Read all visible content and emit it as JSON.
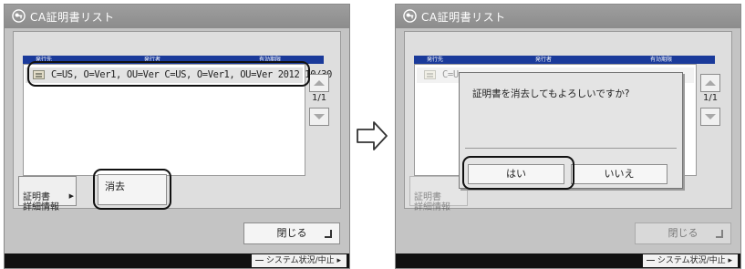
{
  "left_screen": {
    "title": "CA証明書リスト",
    "columns": [
      "発行先",
      "発行者",
      "有効期限"
    ],
    "rows": [
      {
        "text": "C=US, O=Ver1, OU=Ver  C=US, O=Ver1, OU=Ver  2012 10/30",
        "icon": "certificate-icon"
      }
    ],
    "page_indicator": "1/1",
    "details_button": "証明書\n詳細情報",
    "delete_button": "消去",
    "close_button": "閉じる",
    "status_button": "システム状況/中止"
  },
  "right_screen": {
    "title": "CA証明書リスト",
    "columns": [
      "発行先",
      "発行者",
      "有効期限"
    ],
    "row_partial": "C=U",
    "page_indicator": "1/1",
    "details_button_partial": "証明書\n詳細情報",
    "close_button": "閉じる",
    "status_button": "システム状況/中止",
    "dialog": {
      "message": "証明書を消去してもよろしいですか?",
      "yes_button": "はい",
      "no_button": "いいえ"
    }
  },
  "colors": {
    "header_bar": "#1a3a9a",
    "screen_bg": "#c4c4c4",
    "status_bar": "#111111",
    "highlight": "#111111"
  }
}
